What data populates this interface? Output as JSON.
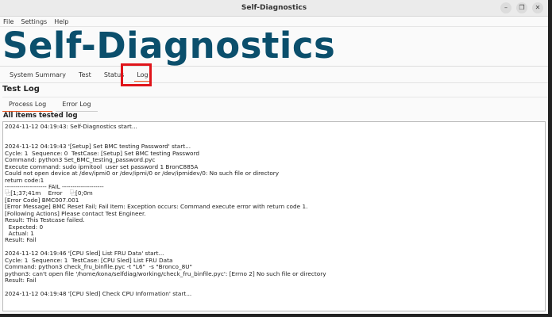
{
  "window": {
    "title": "Self-Diagnostics",
    "controls": [
      "–",
      "❐",
      "✕"
    ]
  },
  "menu": [
    "File",
    "Settings",
    "Help"
  ],
  "app_title": "Self-Diagnostics",
  "tabs": [
    "System Summary",
    "Test",
    "Status",
    "Log"
  ],
  "active_tab": "Log",
  "section_title": "Test Log",
  "subtabs": [
    "Process Log",
    "Error Log"
  ],
  "log_title": "All items tested log",
  "log_lines": [
    "2024-11-12 04:19:43: Self-Diagnostics start...",
    "",
    "",
    "2024-11-12 04:19:43 '[Setup] Set BMC testing Password' start...",
    "Cycle: 1  Sequence: 0  TestCase: [Setup] Set BMC testing Password",
    "Command: python3 Set_BMC_testing_password.pyc",
    "Execute command: sudo ipmitool  user set password 1 BronC885A",
    "Could not open device at /dev/ipmi0 or /dev/ipmi/0 or /dev/ipmidev/0: No such file or directory",
    "return code:1",
    "-------------------- FAIL --------------------",
    "⿻[1;37;41m    Error    ⿻[0;0m",
    "[Error Code] BMC007.001",
    "[Error Message] BMC Reset Fail; Fail Item: Exception occurs: Command execute error with return code 1.",
    "[Following Actions] Please contact Test Engineer.",
    "Result: This Testcase failed.",
    "  Expected: 0",
    "  Actual: 1",
    "Result: Fail",
    "",
    "2024-11-12 04:19:46 '[CPU Sled] List FRU Data' start...",
    "Cycle: 1  Sequence: 1  TestCase: [CPU Sled] List FRU Data",
    "Command: python3 check_fru_binfile.pyc -t \"L6\"  -s \"Bronco_8U\"",
    "python3: can't open file '/home/kona/selfdiag/working/check_fru_binfile.pyc': [Errno 2] No such file or directory",
    "Result: Fail",
    "",
    "2024-11-12 04:19:48 '[CPU Sled] Check CPU Information' start..."
  ]
}
